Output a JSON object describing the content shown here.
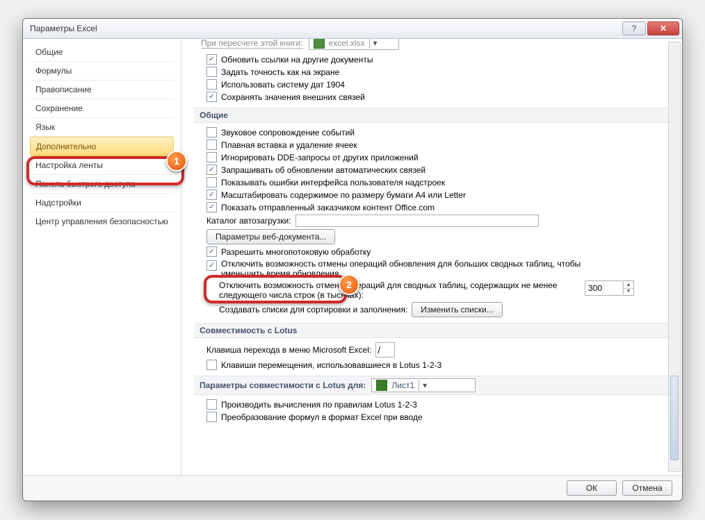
{
  "title": "Параметры Excel",
  "sidebar": {
    "items": [
      {
        "label": "Общие"
      },
      {
        "label": "Формулы"
      },
      {
        "label": "Правописание"
      },
      {
        "label": "Сохранение"
      },
      {
        "label": "Язык"
      },
      {
        "label": "Дополнительно"
      },
      {
        "label": "Настройка ленты"
      },
      {
        "label": "Панель быстрого доступа"
      },
      {
        "label": "Надстройки"
      },
      {
        "label": "Центр управления безопасностью"
      }
    ],
    "active_index": 5
  },
  "toprow": {
    "label": "При пересчете этой книги:",
    "value": "excel.xlsx"
  },
  "recalc_group": [
    {
      "checked": true,
      "text": "Обновить ссылки на другие документы"
    },
    {
      "checked": false,
      "text": "Задать точность как на экране"
    },
    {
      "checked": false,
      "text": "Использовать систему дат 1904"
    },
    {
      "checked": true,
      "text": "Сохранять значения внешних связей"
    }
  ],
  "general_header": "Общие",
  "general_group1": [
    {
      "checked": false,
      "text": "Звуковое сопровождение событий"
    },
    {
      "checked": false,
      "text": "Плавная вставка и удаление ячеек"
    },
    {
      "checked": false,
      "text": "Игнорировать DDE-запросы от других приложений"
    },
    {
      "checked": true,
      "text": "Запрашивать об обновлении автоматических связей"
    },
    {
      "checked": false,
      "text": "Показывать ошибки интерфейса пользователя надстроек"
    },
    {
      "checked": true,
      "text": "Масштабировать содержимое по размеру бумаги A4 или Letter"
    },
    {
      "checked": true,
      "text": "Показать отправленный заказчиком контент Office.com"
    }
  ],
  "autoload": {
    "label": "Каталог автозагрузки:",
    "value": ""
  },
  "web_btn": "Параметры веб-документа...",
  "multithread": {
    "checked": true,
    "text": "Разрешить многопотоковую обработку"
  },
  "undo_pivot_big": {
    "checked": true,
    "text": "Отключить возможность отмены операций обновления для больших сводных таблиц, чтобы уменьшить время обновления"
  },
  "undo_pivot_rows": {
    "label": "Отключить возможность отмены операций для сводных таблиц, содержащих не менее следующего числа строк (в тысячах):",
    "value": "300"
  },
  "sort_lists": {
    "label": "Создавать списки для сортировки и заполнения:",
    "button": "Изменить списки..."
  },
  "lotus_compat_header": "Совместимость с Lotus",
  "lotus_menu": {
    "label": "Клавиша перехода в меню Microsoft Excel:",
    "value": "/"
  },
  "lotus_keys": {
    "checked": false,
    "text": "Клавиши перемещения, использовавшиеся в Lotus 1-2-3"
  },
  "lotus_params_for": {
    "label": "Параметры совместимости с Lotus для:",
    "value": "Лист1"
  },
  "lotus_group": [
    {
      "checked": false,
      "text": "Производить вычисления по правилам Lotus 1-2-3"
    },
    {
      "checked": false,
      "text": "Преобразование формул в формат Excel при вводе"
    }
  ],
  "footer": {
    "ok": "ОК",
    "cancel": "Отмена"
  },
  "badges": {
    "b1": "1",
    "b2": "2"
  }
}
